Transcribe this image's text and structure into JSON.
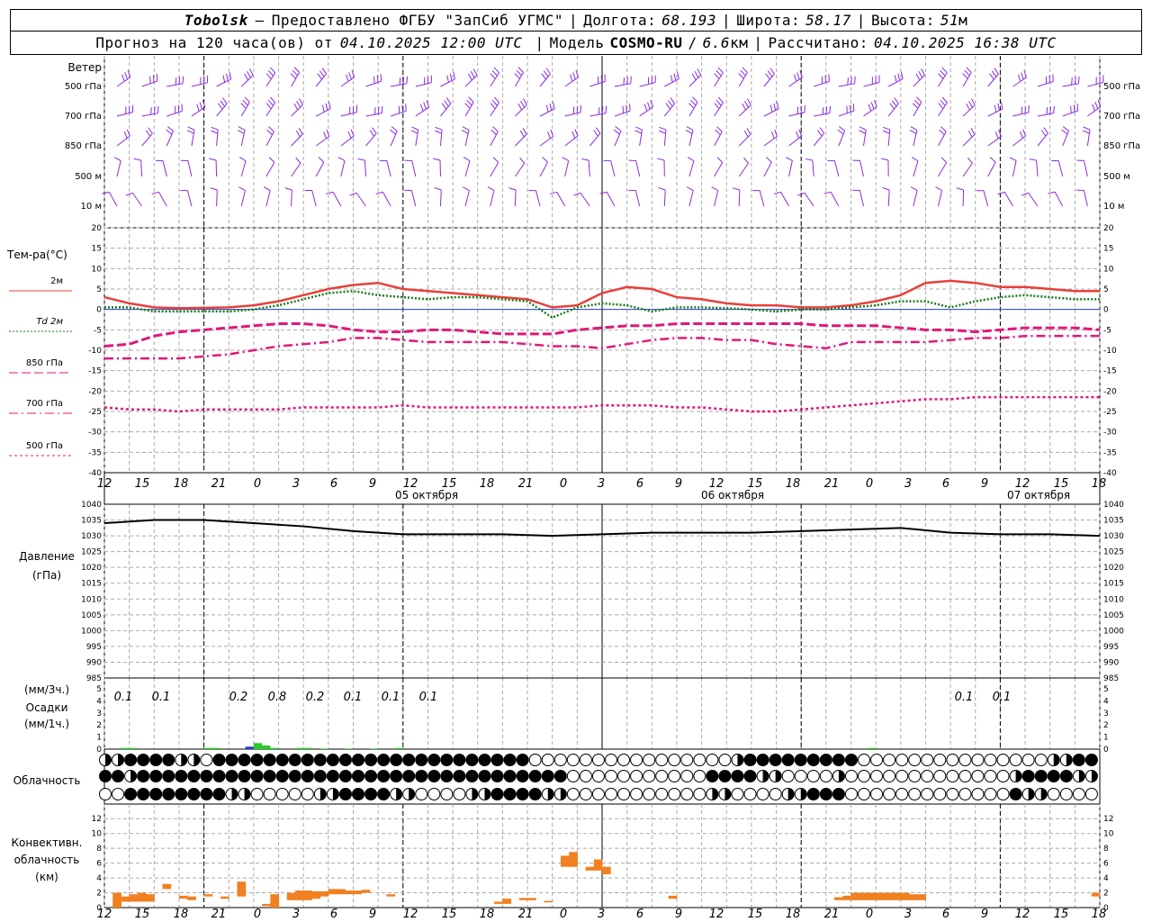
{
  "header": {
    "station": "Tobolsk",
    "dash": "—",
    "provider": "Предоставлено ФГБУ \"ЗапСиб УГМС\"",
    "lon_label": "Долгота:",
    "lon": "68.193",
    "lat_label": "Широта:",
    "lat": "58.17",
    "alt_label": "Высота:",
    "alt": "51",
    "alt_unit": "м",
    "forecast_prefix": "Прогноз на 120 часа(ов) от",
    "forecast_time": "04.10.2025 12:00 UTC",
    "model_label": "Модель",
    "model": "COSMO-RU",
    "model_res": "6.6",
    "model_res_unit": "км",
    "computed_label": "Рассчитано:",
    "computed_time": "04.10.2025 16:38 UTC"
  },
  "wind_panel": {
    "title": "Ветер",
    "levels": [
      "500 гПа",
      "700 гПа",
      "850 гПа",
      "500 м",
      "10 м"
    ],
    "color": "#8a2be2"
  },
  "temp_panel": {
    "title": "Тем-ра(°C)",
    "legend": [
      {
        "label": "2м",
        "color": "#e8403a",
        "style": "solid"
      },
      {
        "label": "Td 2м",
        "color": "#1a7a1a",
        "style": "dotted"
      },
      {
        "label": "850 гПа",
        "color": "#e0187a",
        "style": "dash"
      },
      {
        "label": "700 гПа",
        "color": "#e0187a",
        "style": "dashdot"
      },
      {
        "label": "500 гПа",
        "color": "#e0187a",
        "style": "dot"
      }
    ],
    "ticks": [
      20,
      15,
      10,
      5,
      0,
      -5,
      -10,
      -15,
      -20,
      -25,
      -30,
      -35,
      -40
    ]
  },
  "time_axis": {
    "hour_labels": [
      "12",
      "15",
      "18",
      "21",
      "0",
      "3",
      "6",
      "9",
      "12",
      "15",
      "18",
      "21",
      "0",
      "3",
      "6",
      "9",
      "12",
      "15",
      "18",
      "21",
      "0",
      "3",
      "6",
      "9",
      "12",
      "15",
      "18"
    ],
    "dates": [
      "05 октября",
      "06 октября",
      "07 октября"
    ]
  },
  "pressure_panel": {
    "title": "Давление",
    "unit": "(гПа)",
    "ticks": [
      1040,
      1035,
      1030,
      1025,
      1020,
      1015,
      1010,
      1005,
      1000,
      995,
      990,
      985
    ]
  },
  "precip_panel": {
    "title_3h": "(мм/3ч.)",
    "title": "Осадки",
    "title_1h": "(мм/1ч.)",
    "ticks": [
      5,
      4,
      3,
      2,
      1,
      0
    ],
    "labels_3h": [
      "0.1",
      "0.1",
      "0.2",
      "0.8",
      "0.2",
      "0.1",
      "0.1",
      "0.1",
      "0.1",
      "0.1"
    ]
  },
  "cloud_panel": {
    "title": "Облачность"
  },
  "conv_panel": {
    "title_1": "Конвективн.",
    "title_2": "облачность",
    "title_3": "(км)",
    "ticks": [
      12,
      10,
      8,
      6,
      4,
      2,
      0
    ],
    "color": "#f08020"
  },
  "chart_data": [
    {
      "type": "line",
      "title": "Тем-ра(°C)",
      "x_hours_from_start": [
        0,
        3,
        6,
        9,
        12,
        15,
        18,
        21,
        24,
        27,
        30,
        33,
        36,
        39,
        42,
        45,
        48,
        51,
        54,
        57,
        60,
        63,
        66,
        69,
        72,
        75,
        78,
        81,
        84,
        87,
        90,
        93,
        96,
        99,
        102,
        105,
        108,
        111,
        114,
        117,
        120
      ],
      "ylim": [
        -40,
        20
      ],
      "series": [
        {
          "name": "2м",
          "values": [
            3,
            1.5,
            0.5,
            0.3,
            0.4,
            0.5,
            1,
            2,
            3.5,
            5,
            6,
            6.5,
            5,
            4.5,
            4,
            3.5,
            3,
            2.5,
            0.5,
            1,
            4,
            5.5,
            5,
            3,
            2.5,
            1.5,
            1,
            1,
            0.5,
            0.5,
            1,
            2,
            3.5,
            6.5,
            7,
            6.5,
            5.5,
            5.5,
            5,
            4.5,
            4.5
          ]
        },
        {
          "name": "Td 2м",
          "values": [
            0.5,
            0.5,
            -0.5,
            -0.5,
            -0.5,
            -0.5,
            0,
            1,
            2.5,
            4,
            4.5,
            3.5,
            3,
            2.5,
            3,
            3,
            2.5,
            2,
            -2,
            0.5,
            1.5,
            1,
            -0.5,
            0.5,
            0.5,
            0.3,
            0,
            -0.5,
            0,
            0,
            0.5,
            1,
            2,
            2,
            0.5,
            2,
            3,
            3.5,
            3,
            2.5,
            2.5
          ]
        },
        {
          "name": "850 гПа",
          "values": [
            -9,
            -8.5,
            -6.5,
            -5.5,
            -5,
            -4.5,
            -4,
            -3.5,
            -3.5,
            -4,
            -5,
            -5.5,
            -5.5,
            -5,
            -5,
            -5.5,
            -6,
            -6,
            -6,
            -5,
            -4.5,
            -4,
            -4,
            -3.5,
            -3.5,
            -3.5,
            -3.5,
            -3.5,
            -3.5,
            -4,
            -4,
            -4,
            -4.5,
            -5,
            -5,
            -5.5,
            -5,
            -4.5,
            -4.5,
            -4.5,
            -5
          ]
        },
        {
          "name": "700 гПа",
          "values": [
            -12,
            -12,
            -12,
            -12,
            -11.5,
            -11,
            -10,
            -9,
            -8.5,
            -8,
            -7,
            -7,
            -7.5,
            -8,
            -8,
            -8,
            -8,
            -8.5,
            -9,
            -9,
            -9.5,
            -8.5,
            -7.5,
            -7,
            -7,
            -7.5,
            -7.5,
            -8.5,
            -9,
            -9.5,
            -8,
            -8,
            -8,
            -8,
            -7.5,
            -7,
            -7,
            -6.5,
            -6.5,
            -6.5,
            -6.5
          ]
        },
        {
          "name": "500 гПа",
          "values": [
            -24,
            -24.5,
            -24.5,
            -25,
            -24.5,
            -24.5,
            -24.5,
            -24.5,
            -24,
            -24,
            -24,
            -24,
            -23.5,
            -24,
            -24,
            -24,
            -24,
            -24,
            -24,
            -24,
            -23.5,
            -23.5,
            -23.5,
            -24,
            -24,
            -24.5,
            -25,
            -25,
            -24.5,
            -24,
            -23.5,
            -23,
            -22.5,
            -22,
            -22,
            -21.5,
            -21.5,
            -21.5,
            -21.5,
            -21.5,
            -21.5
          ]
        }
      ]
    },
    {
      "type": "line",
      "title": "Давление",
      "x_hours_from_start": [
        0,
        6,
        12,
        18,
        24,
        30,
        36,
        42,
        48,
        54,
        60,
        66,
        72,
        78,
        84,
        90,
        96,
        102,
        108,
        114,
        120
      ],
      "ylim": [
        985,
        1040
      ],
      "series": [
        {
          "name": "Давление",
          "values": [
            1034,
            1035,
            1035,
            1034,
            1033,
            1031.5,
            1030.5,
            1030.5,
            1030.5,
            1030,
            1030.5,
            1031,
            1031,
            1031,
            1031.5,
            1032,
            1032.5,
            1031,
            1030.5,
            1030.5,
            1030
          ]
        }
      ]
    },
    {
      "type": "bar",
      "title": "Осадки",
      "ylim": [
        0,
        5
      ],
      "hourly_mm": [
        {
          "h": 2,
          "v": 0.1
        },
        {
          "h": 3,
          "v": 0.1
        },
        {
          "h": 12,
          "v": 0.1
        },
        {
          "h": 13,
          "v": 0.1
        },
        {
          "h": 17,
          "v": 0.2
        },
        {
          "h": 18,
          "v": 0.5
        },
        {
          "h": 19,
          "v": 0.3
        },
        {
          "h": 20,
          "v": 0.1
        },
        {
          "h": 23,
          "v": 0.1
        },
        {
          "h": 24,
          "v": 0.1
        },
        {
          "h": 26,
          "v": 0.05
        },
        {
          "h": 29,
          "v": 0.05
        },
        {
          "h": 32,
          "v": 0.05
        },
        {
          "h": 35,
          "v": 0.1
        },
        {
          "h": 92,
          "v": 0.1
        }
      ],
      "precip_colors": {
        "rain": "#22cc22",
        "snow": "#2233dd"
      }
    },
    {
      "type": "bar",
      "title": "Конвективн. облачность",
      "ylim": [
        0,
        13
      ],
      "segments_km": [
        {
          "h": 1,
          "b": 0,
          "t": 2
        },
        {
          "h": 2,
          "b": 0.8,
          "t": 1.5
        },
        {
          "h": 3,
          "b": 0.8,
          "t": 1.8
        },
        {
          "h": 4,
          "b": 0.8,
          "t": 2
        },
        {
          "h": 5,
          "b": 0.8,
          "t": 1.8
        },
        {
          "h": 7,
          "b": 2.5,
          "t": 3.2
        },
        {
          "h": 9,
          "b": 1.2,
          "t": 1.6
        },
        {
          "h": 10,
          "b": 1,
          "t": 1.5
        },
        {
          "h": 12,
          "b": 1.5,
          "t": 1.8
        },
        {
          "h": 14,
          "b": 1.2,
          "t": 1.5
        },
        {
          "h": 16,
          "b": 1.5,
          "t": 3.5
        },
        {
          "h": 19,
          "b": 0.2,
          "t": 0.5
        },
        {
          "h": 20,
          "b": 0,
          "t": 1.8
        },
        {
          "h": 22,
          "b": 1,
          "t": 2
        },
        {
          "h": 23,
          "b": 1,
          "t": 2.3
        },
        {
          "h": 24,
          "b": 1,
          "t": 2.3
        },
        {
          "h": 25,
          "b": 1.2,
          "t": 2.2
        },
        {
          "h": 26,
          "b": 1.5,
          "t": 2.2
        },
        {
          "h": 27,
          "b": 1.8,
          "t": 2.5
        },
        {
          "h": 28,
          "b": 1.8,
          "t": 2.5
        },
        {
          "h": 29,
          "b": 1.8,
          "t": 2.3
        },
        {
          "h": 30,
          "b": 1.8,
          "t": 2.3
        },
        {
          "h": 31,
          "b": 2,
          "t": 2.4
        },
        {
          "h": 34,
          "b": 1.5,
          "t": 1.8
        },
        {
          "h": 47,
          "b": 0.5,
          "t": 0.8
        },
        {
          "h": 48,
          "b": 0.5,
          "t": 1.2
        },
        {
          "h": 50,
          "b": 1,
          "t": 1.3
        },
        {
          "h": 51,
          "b": 1,
          "t": 1.3
        },
        {
          "h": 53,
          "b": 0.7,
          "t": 0.9
        },
        {
          "h": 55,
          "b": 5.5,
          "t": 7
        },
        {
          "h": 56,
          "b": 5.5,
          "t": 7.5
        },
        {
          "h": 58,
          "b": 5,
          "t": 5.5
        },
        {
          "h": 59,
          "b": 5,
          "t": 6.5
        },
        {
          "h": 60,
          "b": 4.5,
          "t": 5.5
        },
        {
          "h": 68,
          "b": 1.2,
          "t": 1.6
        },
        {
          "h": 88,
          "b": 1,
          "t": 1.4
        },
        {
          "h": 89,
          "b": 1,
          "t": 1.6
        },
        {
          "h": 90,
          "b": 1,
          "t": 2
        },
        {
          "h": 91,
          "b": 1,
          "t": 2
        },
        {
          "h": 92,
          "b": 1,
          "t": 2
        },
        {
          "h": 93,
          "b": 1,
          "t": 2
        },
        {
          "h": 94,
          "b": 1,
          "t": 2
        },
        {
          "h": 95,
          "b": 1,
          "t": 2
        },
        {
          "h": 96,
          "b": 1,
          "t": 2
        },
        {
          "h": 97,
          "b": 1,
          "t": 1.8
        },
        {
          "h": 98,
          "b": 1,
          "t": 1.8
        },
        {
          "h": 119,
          "b": 1.5,
          "t": 2
        }
      ]
    }
  ]
}
